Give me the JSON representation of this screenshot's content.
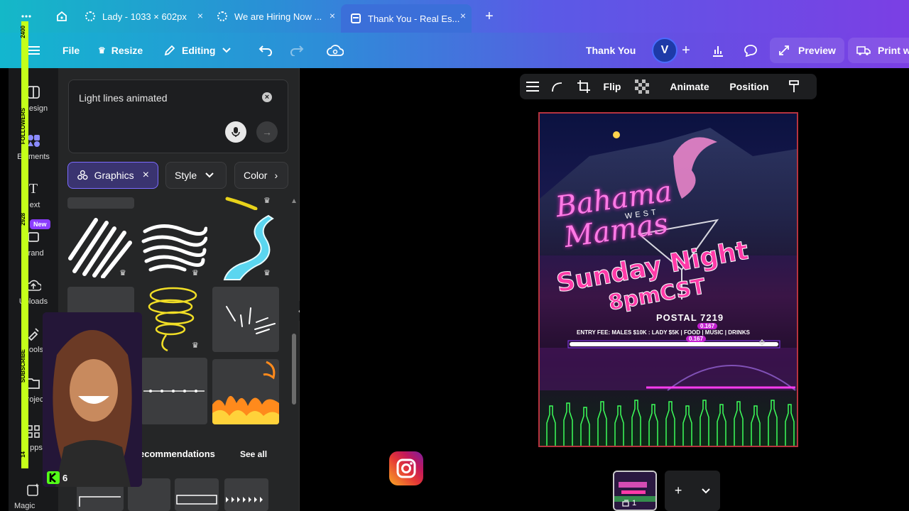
{
  "browser": {
    "tabs": [
      {
        "label": "Lady - 1033 × 602px",
        "close": "×"
      },
      {
        "label": "We are Hiring Now ...",
        "close": "×"
      },
      {
        "label": "Thank You - Real Es...",
        "close": "×"
      }
    ],
    "new_tab": "+"
  },
  "topbar": {
    "file": "File",
    "resize": "Resize",
    "editing": "Editing",
    "doc_title": "Thank You",
    "avatar": "V",
    "preview": "Preview",
    "print": "Print wi"
  },
  "sidebar": {
    "items": [
      "esign",
      "Elements",
      "ext",
      "Brand",
      "Uploads",
      "ools",
      "roject",
      "pps",
      "Magic Media"
    ],
    "new_badge": "New",
    "strip_labels": [
      "2400",
      "FOLLOWERS",
      "2928",
      "SUBSCRIBE",
      "14"
    ]
  },
  "panel": {
    "search_text": "Light lines animated",
    "chips": {
      "graphics": "Graphics",
      "style": "Style",
      "color": "Color"
    },
    "recommendations": "ecommendations",
    "see_all": "See all",
    "webcam_count": "6"
  },
  "context_toolbar": {
    "flip": "Flip",
    "animate": "Animate",
    "position": "Position"
  },
  "design": {
    "brand_line1": "Bahama",
    "brand_middle": "WEST",
    "brand_line2": "Mamas",
    "headline1": "Sunday Night",
    "headline2": "8pmCST",
    "address": "POSTAL 7219",
    "entry": "ENTRY FEE: MALES $10K : LADY $5K | FOOD | MUSIC | DRINKS",
    "measure1": "0.167",
    "measure2": "0.167"
  },
  "pages": {
    "current": "1"
  },
  "colors": {
    "accent": "#8b3dff",
    "canvas_border": "#b7333f",
    "neon_pink": "#ff4fd8",
    "neon_green": "#3dff5a",
    "strip": "#c4ff1a"
  }
}
